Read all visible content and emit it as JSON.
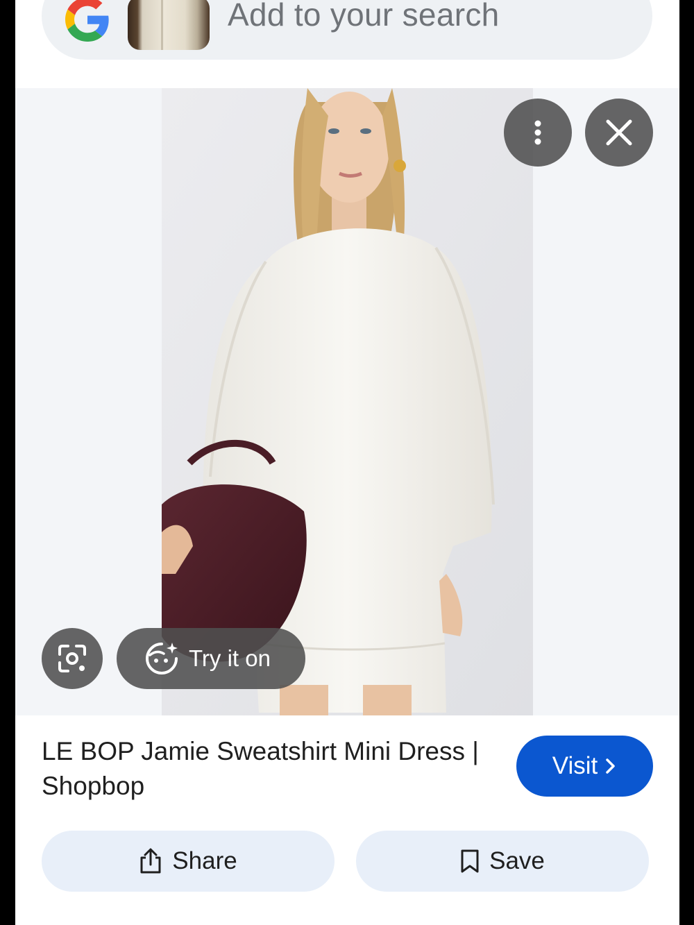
{
  "search": {
    "placeholder": "Add to your search",
    "logo_icon": "google-g-icon",
    "thumbnail_icon": "query-image-thumbnail"
  },
  "viewer": {
    "menu_icon": "more-vert-icon",
    "close_icon": "close-icon",
    "lens_icon": "lens-search-icon",
    "try_on": {
      "icon": "sparkle-face-icon",
      "label": "Try it on"
    }
  },
  "result": {
    "title": "LE BOP Jamie Sweatshirt Mini Dress | Shopbop",
    "visit": {
      "label": "Visit",
      "icon": "chevron-right-icon"
    }
  },
  "actions": {
    "share": {
      "label": "Share",
      "icon": "share-icon"
    },
    "save": {
      "label": "Save",
      "icon": "bookmark-icon"
    }
  },
  "colors": {
    "accent": "#0b57d0",
    "action_bg": "#e8eff9",
    "search_bg": "#eef1f4",
    "stage_bg": "#f3f5f8",
    "overlay_btn": "#505050"
  }
}
